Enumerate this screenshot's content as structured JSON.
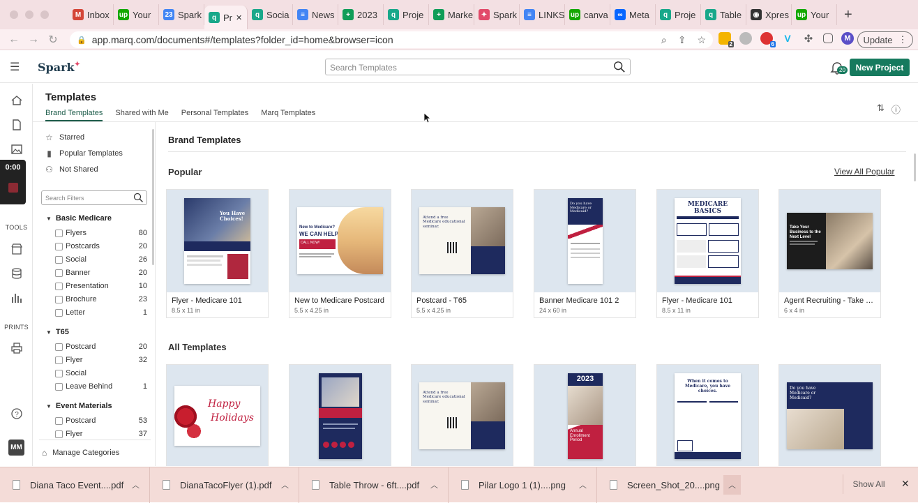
{
  "browser": {
    "tabs": [
      {
        "label": "Inbox",
        "icon": "gmail-icon",
        "color": "#d44638"
      },
      {
        "label": "Your",
        "icon": "upwork-icon",
        "color": "#14a800"
      },
      {
        "label": "Spark",
        "icon": "calendar-icon",
        "color": "#4285f4"
      },
      {
        "label": "Pr",
        "icon": "marq-icon",
        "color": "#19a88a",
        "active": true
      },
      {
        "label": "Socia",
        "icon": "marq-icon",
        "color": "#19a88a"
      },
      {
        "label": "News",
        "icon": "docs-icon",
        "color": "#4285f4"
      },
      {
        "label": "2023",
        "icon": "sheets-icon",
        "color": "#0f9d58"
      },
      {
        "label": "Proje",
        "icon": "marq-icon",
        "color": "#19a88a"
      },
      {
        "label": "Marke",
        "icon": "sheets-icon",
        "color": "#0f9d58"
      },
      {
        "label": "Spark",
        "icon": "spark-icon",
        "color": "#e24a6a"
      },
      {
        "label": "LINKS",
        "icon": "docs-icon",
        "color": "#4285f4"
      },
      {
        "label": "canva",
        "icon": "upwork-icon",
        "color": "#14a800"
      },
      {
        "label": "Meta",
        "icon": "meta-icon",
        "color": "#0866ff"
      },
      {
        "label": "Proje",
        "icon": "marq-icon",
        "color": "#19a88a"
      },
      {
        "label": "Table",
        "icon": "marq-icon",
        "color": "#19a88a"
      },
      {
        "label": "Xpres",
        "icon": "globe-icon",
        "color": "#333333"
      },
      {
        "label": "Your",
        "icon": "upwork-icon",
        "color": "#14a800"
      }
    ],
    "url": "app.marq.com/documents#/templates?folder_id=home&browser=icon",
    "update_label": "Update",
    "profile_initial": "M",
    "ext_badge_1": "2",
    "ext_badge_2": "6"
  },
  "app": {
    "logo": "Spark",
    "search_placeholder": "Search Templates",
    "notification_count": "20",
    "new_project_label": "New Project",
    "rail": {
      "tools_label": "TOOLS",
      "prints_label": "PRINTS",
      "user_initials": "MM",
      "timer": "0:00"
    },
    "page_title": "Templates",
    "tabs": [
      "Brand Templates",
      "Shared with Me",
      "Personal Templates",
      "Marq Templates"
    ],
    "quick_filters": [
      {
        "label": "Starred",
        "icon": "star-icon"
      },
      {
        "label": "Popular Templates",
        "icon": "bar-chart-icon"
      },
      {
        "label": "Not Shared",
        "icon": "person-icon"
      }
    ],
    "filter_search_placeholder": "Search Filters",
    "categories": [
      {
        "name": "Basic Medicare",
        "items": [
          {
            "label": "Flyers",
            "count": "80"
          },
          {
            "label": "Postcards",
            "count": "20"
          },
          {
            "label": "Social",
            "count": "26"
          },
          {
            "label": "Banner",
            "count": "20"
          },
          {
            "label": "Presentation",
            "count": "10"
          },
          {
            "label": "Brochure",
            "count": "23"
          },
          {
            "label": "Letter",
            "count": "1"
          }
        ]
      },
      {
        "name": "T65",
        "items": [
          {
            "label": "Postcard",
            "count": "20"
          },
          {
            "label": "Flyer",
            "count": "32"
          },
          {
            "label": "Social",
            "count": ""
          },
          {
            "label": "Leave Behind",
            "count": "1"
          }
        ]
      },
      {
        "name": "Event Materials",
        "items": [
          {
            "label": "Postcard",
            "count": "53"
          },
          {
            "label": "Flyer",
            "count": "37"
          }
        ]
      }
    ],
    "manage_categories": "Manage Categories",
    "section_title": "Brand Templates",
    "popular_label": "Popular",
    "view_all_popular": "View All Popular",
    "all_templates_label": "All Templates",
    "popular": [
      {
        "title": "Flyer - Medicare 101",
        "size": "8.5 x 11 in"
      },
      {
        "title": "New to Medicare Postcard",
        "size": "5.5 x 4.25 in"
      },
      {
        "title": "Postcard - T65",
        "size": "5.5 x 4.25 in"
      },
      {
        "title": "Banner Medicare 101 2",
        "size": "24 x 60 in"
      },
      {
        "title": "Flyer - Medicare 101",
        "size": "8.5 x 11 in"
      },
      {
        "title": "Agent Recruiting - Take Your Business",
        "size": "6 x 4 in"
      }
    ],
    "thumb_text": {
      "choices": "You Have Choices!",
      "new_to_medicare": "New to Medicare?",
      "we_can_help": "WE CAN HELP!",
      "call_now": "CALL NOW!",
      "attend_seminar": "Attend a free Medicare educational seminar.",
      "medicare_basics": "MEDICARE BASICS",
      "take_business": "Take Your Business to the Next Level",
      "happy": "Happy",
      "holidays": "Holidays",
      "year": "2023",
      "annual_enrollment": "Annual Enrollment Period",
      "choices2": "When it comes to Medicare, you have choices.",
      "do_you_have": "Do you have Medicare or Medicaid?"
    }
  },
  "downloads": {
    "items": [
      "Diana Taco Event....pdf",
      "DianaTacoFlyer (1).pdf",
      "Table Throw - 6ft....pdf",
      "Pilar Logo 1  (1)....png",
      "Screen_Shot_20....png"
    ],
    "show_all_label": "Show All"
  }
}
